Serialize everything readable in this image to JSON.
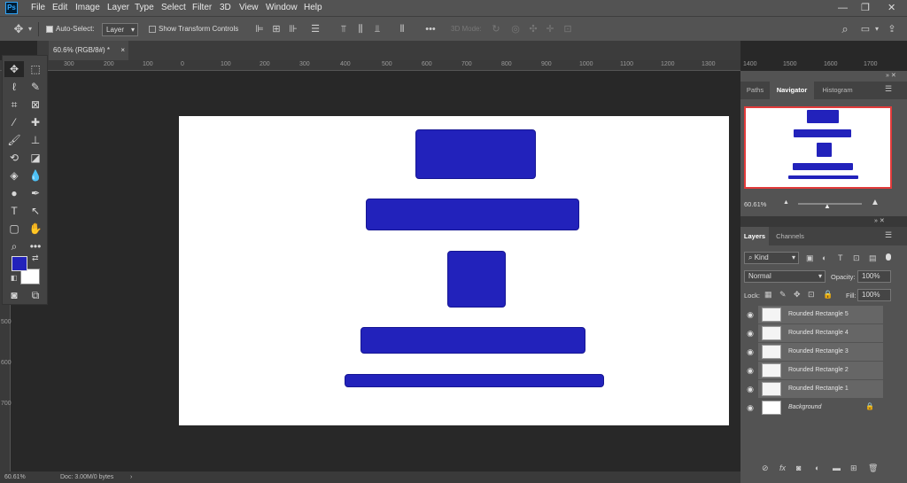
{
  "menubar": {
    "logo": "Ps",
    "items": [
      "File",
      "Edit",
      "Image",
      "Layer",
      "Type",
      "Select",
      "Filter",
      "3D",
      "View",
      "Window",
      "Help"
    ],
    "window_controls": [
      "—",
      "❐",
      "✕"
    ]
  },
  "options_bar": {
    "auto_select_label": "Auto-Select:",
    "auto_select_target": "Layer",
    "show_transform_label": "Show Transform Controls",
    "mode_3d_label": "3D Mode:"
  },
  "document": {
    "tab_title": "60.6% (RGB/8#) *",
    "zoom": "60.61%",
    "doc_info": "Doc: 3.00M/0 bytes"
  },
  "rulers": {
    "horizontal": [
      "300",
      "200",
      "100",
      "0",
      "100",
      "200",
      "300",
      "400",
      "500",
      "600",
      "700",
      "800",
      "900",
      "1000",
      "1100",
      "1200",
      "1300",
      "1400",
      "1500",
      "1600",
      "1700"
    ],
    "vertical": [
      "500",
      "600",
      "700"
    ]
  },
  "colors": {
    "foreground": "#2222bb",
    "background": "#ffffff",
    "shape_fill": "#2222bb",
    "accent_border": "#e23b3b"
  },
  "navigator_panel": {
    "tabs": [
      "Paths",
      "Navigator",
      "Histogram"
    ],
    "active_tab": "Navigator",
    "zoom": "60.61%"
  },
  "layers_panel": {
    "tabs": [
      "Layers",
      "Channels"
    ],
    "active_tab": "Layers",
    "filter_kind": "Kind",
    "blend_mode": "Normal",
    "opacity_label": "Opacity:",
    "opacity_value": "100%",
    "lock_label": "Lock:",
    "fill_label": "Fill:",
    "fill_value": "100%",
    "layers": [
      {
        "name": "Rounded Rectangle 5"
      },
      {
        "name": "Rounded Rectangle 4"
      },
      {
        "name": "Rounded Rectangle 3"
      },
      {
        "name": "Rounded Rectangle 2"
      },
      {
        "name": "Rounded Rectangle 1"
      },
      {
        "name": "Background"
      }
    ]
  }
}
